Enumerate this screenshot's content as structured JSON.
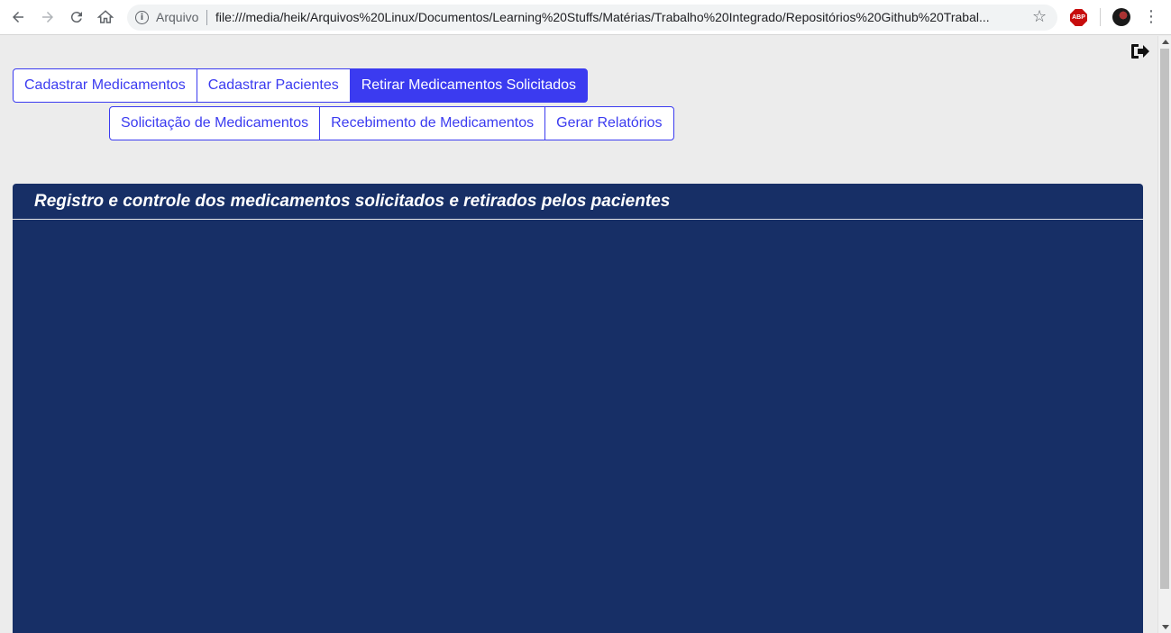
{
  "browser": {
    "scheme_label": "Arquivo",
    "url": "file:///media/heik/Arquivos%20Linux/Documentos/Learning%20Stuffs/Matérias/Trabalho%20Integrado/Repositórios%20Github%20Trabal...",
    "extension_label": "ABP"
  },
  "nav": {
    "primary": [
      {
        "label": "Cadastrar Medicamentos",
        "active": false
      },
      {
        "label": "Cadastrar Pacientes",
        "active": false
      },
      {
        "label": "Retirar Medicamentos Solicitados",
        "active": true
      }
    ],
    "secondary": [
      {
        "label": "Solicitação de Medicamentos"
      },
      {
        "label": "Recebimento de Medicamentos"
      },
      {
        "label": "Gerar Relatórios"
      }
    ]
  },
  "panel": {
    "title": "Registro e controle dos medicamentos solicitados e retirados pelos pacientes"
  },
  "colors": {
    "accent": "#3b3bf0",
    "panel_bg": "#172f66",
    "page_bg": "#ececec"
  },
  "icons": {
    "logout": "sign-out-icon"
  }
}
